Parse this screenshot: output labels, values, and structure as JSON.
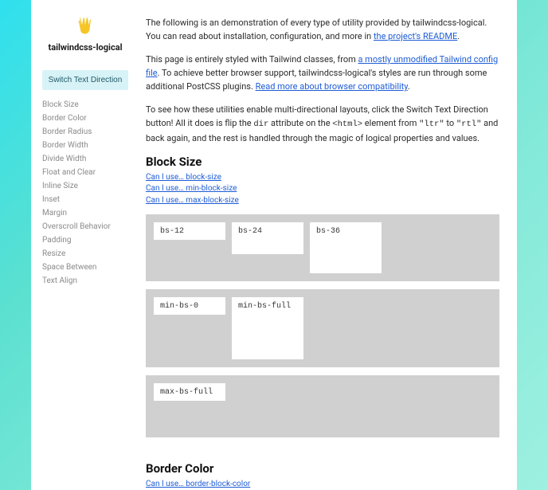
{
  "brand": "tailwindcss-logical",
  "switch_label": "Switch Text Direction",
  "nav": [
    "Block Size",
    "Border Color",
    "Border Radius",
    "Border Width",
    "Divide Width",
    "Float and Clear",
    "Inline Size",
    "Inset",
    "Margin",
    "Overscroll Behavior",
    "Padding",
    "Resize",
    "Space Between",
    "Text Align"
  ],
  "intro": {
    "p1a": "The following is an demonstration of every type of utility provided by tailwindcss-logical. You can read about installation, configuration, and more in ",
    "p1link": "the project's README",
    "p2a": "This page is entirely styled with Tailwind classes, from ",
    "p2link1": "a mostly unmodified Tailwind config file",
    "p2b": ". To achieve better browser support, tailwindcss-logical's styles are run through some additional PostCSS plugins. ",
    "p2link2": "Read more about browser compatibility",
    "p3a": "To see how these utilities enable multi-directional layouts, click the Switch Text Direction button! All it does is flip the ",
    "p3c1": "dir",
    "p3b": " attribute on the ",
    "p3c2": "<html>",
    "p3c": " element from ",
    "p3c3": "\"ltr\"",
    "p3d": " to ",
    "p3c4": "\"rtl\"",
    "p3e": " and back again, and the rest is handled through the magic of logical properties and values."
  },
  "sections": {
    "block_size": {
      "title": "Block Size",
      "links": [
        "Can I use… block-size",
        "Can I use… min-block-size",
        "Can I use… max-block-size"
      ],
      "boxes1": [
        "bs-12",
        "bs-24",
        "bs-36"
      ],
      "boxes2": [
        "min-bs-0",
        "min-bs-full"
      ],
      "boxes3": [
        "max-bs-full"
      ]
    },
    "border_color": {
      "title": "Border Color",
      "links": [
        "Can I use… border-block-color"
      ]
    }
  }
}
